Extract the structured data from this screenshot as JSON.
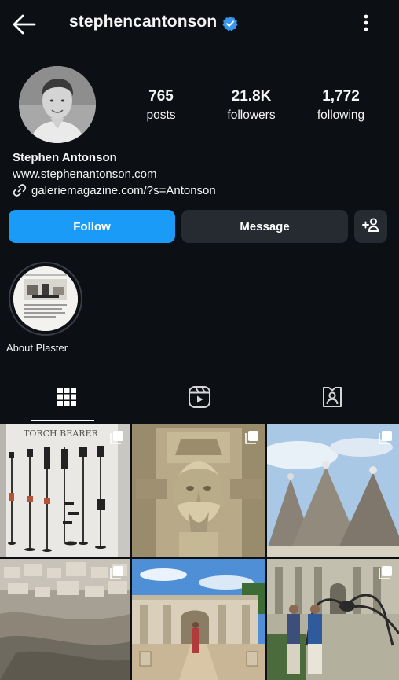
{
  "header": {
    "username": "stephencantonson",
    "back_icon": "arrow-left-icon",
    "verified_icon": "verified-badge-icon",
    "menu_icon": "more-vertical-icon"
  },
  "profile": {
    "avatar_icon": "profile-photo",
    "stats": {
      "posts": {
        "value": "765",
        "label": "posts"
      },
      "followers": {
        "value": "21.8K",
        "label": "followers"
      },
      "following": {
        "value": "1,772",
        "label": "following"
      }
    },
    "display_name": "Stephen Antonson",
    "website": "www.stephenantonson.com",
    "link": "galeriemagazine.com/?s=Antonson"
  },
  "actions": {
    "follow_label": "Follow",
    "message_label": "Message",
    "add_user_icon": "add-person-icon"
  },
  "highlights": [
    {
      "label": "About Plaster"
    }
  ],
  "tabs": [
    {
      "name": "posts-grid",
      "icon": "grid-icon",
      "active": true
    },
    {
      "name": "reels",
      "icon": "reels-icon",
      "active": false
    },
    {
      "name": "tagged",
      "icon": "tagged-person-icon",
      "active": false
    }
  ],
  "posts": [
    {
      "subject": "torch-bearer-candlesticks",
      "multi": true,
      "caption_text": "TORCH BEARER"
    },
    {
      "subject": "stone-relief-face",
      "multi": true
    },
    {
      "subject": "trulli-rooftops",
      "multi": true
    },
    {
      "subject": "hillside-town",
      "multi": true
    },
    {
      "subject": "courtyard-villa",
      "multi": false
    },
    {
      "subject": "spider-sculpture-palace",
      "multi": true
    }
  ],
  "colors": {
    "background": "#0c0f14",
    "follow_button": "#1a9bf7",
    "secondary_button": "#262a31",
    "verified": "#3797f0"
  }
}
